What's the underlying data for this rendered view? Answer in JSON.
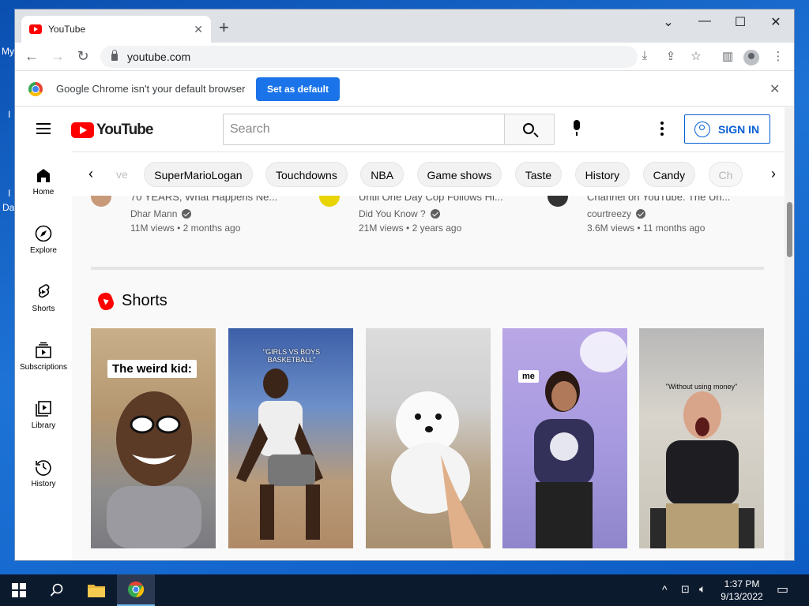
{
  "desktop": {
    "fragments": [
      "My",
      "I",
      "I",
      "Da"
    ]
  },
  "browser": {
    "tab_title": "YouTube",
    "url": "youtube.com",
    "infobar": {
      "message": "Google Chrome isn't your default browser",
      "button": "Set as default"
    }
  },
  "youtube": {
    "logo_text": "YouTube",
    "search_placeholder": "Search",
    "sign_in": "SIGN IN",
    "sidebar": [
      {
        "label": "Home",
        "icon": "home-icon"
      },
      {
        "label": "Explore",
        "icon": "explore-icon"
      },
      {
        "label": "Shorts",
        "icon": "shorts-icon"
      },
      {
        "label": "Subscriptions",
        "icon": "subscriptions-icon"
      },
      {
        "label": "Library",
        "icon": "library-icon"
      },
      {
        "label": "History",
        "icon": "history-icon"
      }
    ],
    "chips": [
      "ve",
      "SuperMarioLogan",
      "Touchdowns",
      "NBA",
      "Game shows",
      "Taste",
      "History",
      "Candy",
      "Ch"
    ],
    "videos": [
      {
        "title_fragment": "70 YEARS, What Happens Ne...",
        "channel": "Dhar Mann",
        "views": "11M views",
        "age": "2 months ago"
      },
      {
        "title_fragment": "Until One Day Cop Follows Hi...",
        "channel": "Did You Know ?",
        "views": "21M views",
        "age": "2 years ago"
      },
      {
        "title_fragment": "Channel on YouTube. The Un...",
        "channel": "courtreezy",
        "views": "3.6M views",
        "age": "11 months ago"
      }
    ],
    "shorts_heading": "Shorts",
    "shorts": [
      {
        "caption": "The weird kid:"
      },
      {
        "caption": "\"GIRLS VS BOYS BASKETBALL\""
      },
      {
        "caption": ""
      },
      {
        "caption": "me"
      },
      {
        "caption": "\"Without using money\""
      }
    ]
  },
  "taskbar": {
    "time": "1:37 PM",
    "date": "9/13/2022"
  },
  "colors": {
    "yt_red": "#ff0000",
    "chrome_blue": "#1a73e8",
    "link_blue": "#065fd4"
  }
}
